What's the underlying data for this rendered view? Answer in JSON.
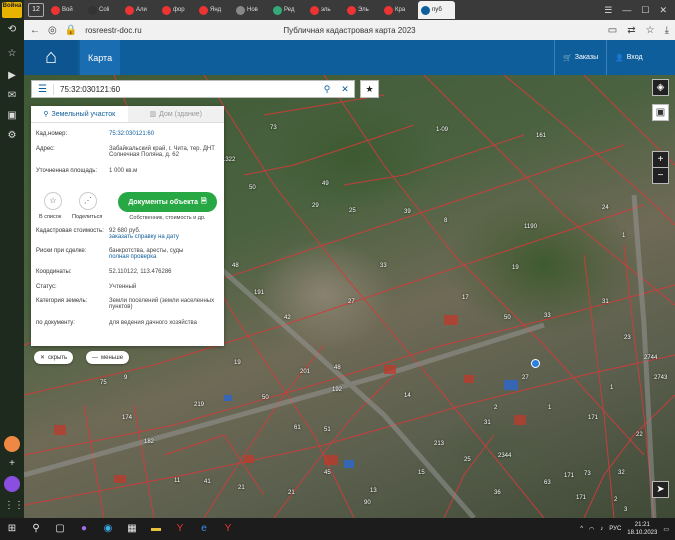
{
  "sidebar": {
    "weather": "Война"
  },
  "browser": {
    "tab_count": "12",
    "tabs": [
      {
        "label": "Вой",
        "color": "#e33"
      },
      {
        "label": "Coli",
        "color": "#333"
      },
      {
        "label": "Али",
        "color": "#e33"
      },
      {
        "label": "фор",
        "color": "#e33"
      },
      {
        "label": "Янд",
        "color": "#e33"
      },
      {
        "label": "Нов",
        "color": "#888"
      },
      {
        "label": "Ред",
        "color": "#3a7"
      },
      {
        "label": "эль",
        "color": "#e33"
      },
      {
        "label": "Эль",
        "color": "#e33"
      },
      {
        "label": "Кра",
        "color": "#e33"
      },
      {
        "label": "пуб",
        "color": "#0e5e9c"
      }
    ],
    "url": "rosreestr-doc.ru",
    "page_title": "Публичная кадастровая карта 2023"
  },
  "header": {
    "map_label": "Карта",
    "orders_label": "Заказы",
    "login_label": "Вход"
  },
  "search": {
    "value": "75:32:030121:60"
  },
  "panel": {
    "tab_land": "Земельный участок",
    "tab_building": "Дом (здание)",
    "cad_label": "Кад.номер:",
    "cad_value": "75:32:030121:60",
    "address_label": "Адрес:",
    "address_value": "Забайкальский край, г. Чита, тер. ДНТ Солнечная Поляна, д. 62",
    "area_label": "Уточненная площадь:",
    "area_value": "1 000 кв.м",
    "to_list": "В список",
    "share": "Поделиться",
    "docs_button": "Документы объекта",
    "docs_sub": "Собственник, стоимость и др.",
    "cost_label": "Кадастровая стоимость:",
    "cost_value": "92 680 руб.",
    "cost_link": "заказать справку на дату",
    "risks_label": "Риски при сделке:",
    "risks_value": "банкротства, аресты, суды",
    "risks_link": "полная проверка",
    "coords_label": "Координаты:",
    "coords_value": "52.110122, 113.476286",
    "status_label": "Статус:",
    "status_value": "Учтенный",
    "category_label": "Категория земель:",
    "category_value": "Земли поселений (земли населенных пунктов)",
    "doc_label": "по документу:",
    "doc_value": "для ведения дачного хозяйства"
  },
  "pills": {
    "hide": "скрыть",
    "less": "меньше"
  },
  "map": {
    "parcel_numbers": [
      "73",
      "1-09",
      "161",
      "1322",
      "49",
      "29",
      "50",
      "25",
      "39",
      "8",
      "1190",
      "24",
      "1",
      "48",
      "191",
      "33",
      "31",
      "27",
      "42",
      "19",
      "17",
      "33",
      "23",
      "48",
      "19",
      "50",
      "27",
      "1",
      "2",
      "9",
      "75",
      "174",
      "182",
      "219",
      "192",
      "14",
      "41",
      "213",
      "21",
      "90",
      "61",
      "51",
      "31",
      "25",
      "63",
      "73",
      "32",
      "22",
      "36",
      "201",
      "2744",
      "2743",
      "2344",
      "15",
      "13",
      "171",
      "171",
      "171",
      "1",
      "21",
      "2",
      "3",
      "11",
      "50",
      "45"
    ]
  },
  "taskbar": {
    "lang": "РУС",
    "time": "21:21",
    "date": "18.10.2023"
  }
}
